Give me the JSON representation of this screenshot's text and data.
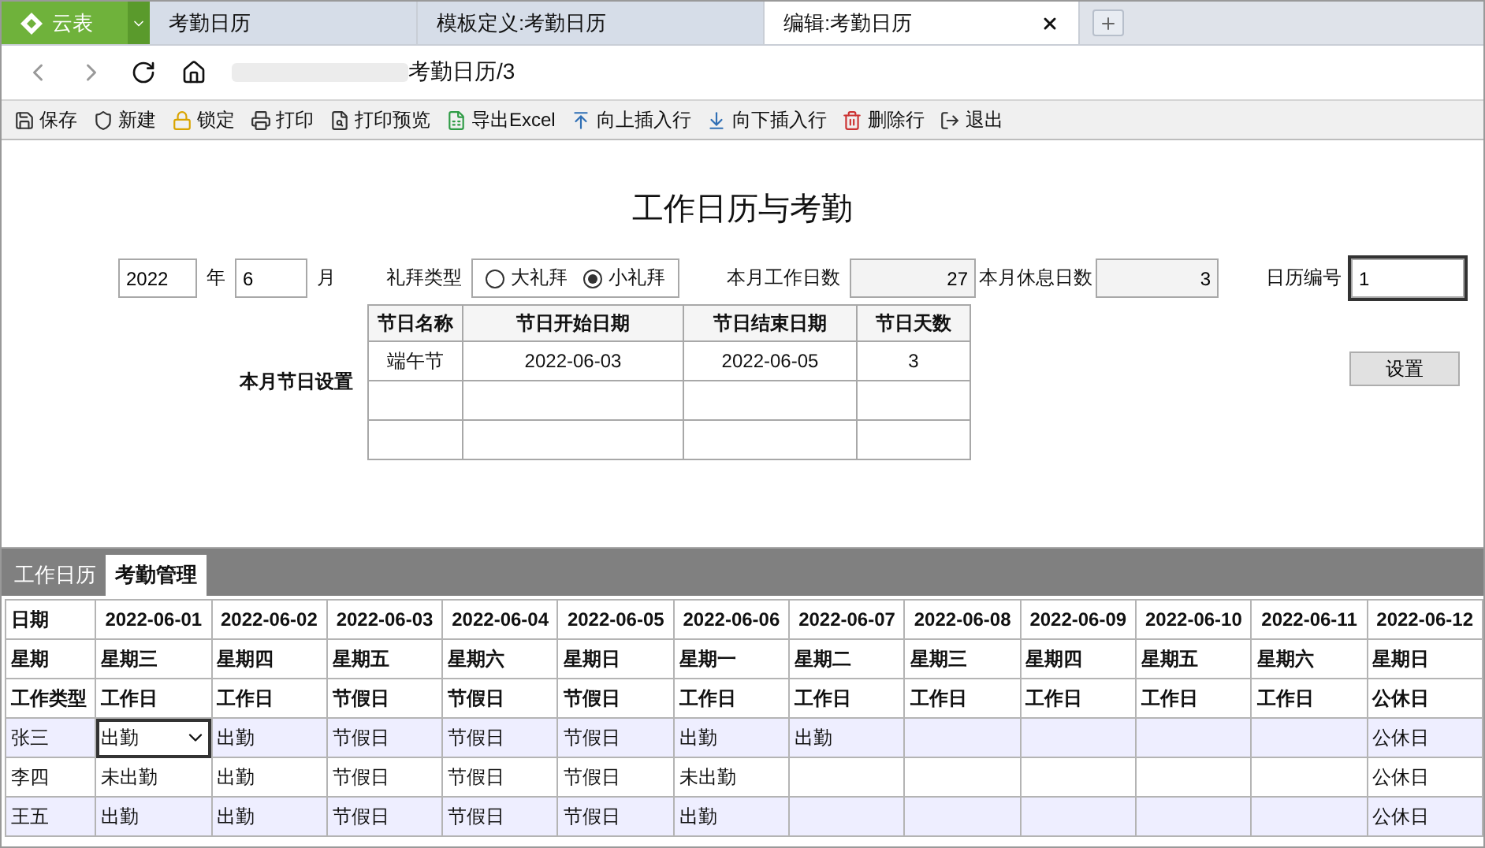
{
  "app_button": {
    "label": "云表"
  },
  "tabs": [
    {
      "label": "考勤日历",
      "selected": false
    },
    {
      "label": "模板定义:考勤日历",
      "selected": false
    },
    {
      "label": "编辑:考勤日历",
      "selected": true
    }
  ],
  "address": {
    "path": "考勤日历/3"
  },
  "toolbar": [
    {
      "label": "保存",
      "kind": "save"
    },
    {
      "label": "新建",
      "kind": "new"
    },
    {
      "label": "锁定",
      "kind": "lock"
    },
    {
      "label": "打印",
      "kind": "print"
    },
    {
      "label": "打印预览",
      "kind": "preview"
    },
    {
      "label": "导出Excel",
      "kind": "excel"
    },
    {
      "label": "向上插入行",
      "kind": "up"
    },
    {
      "label": "向下插入行",
      "kind": "down"
    },
    {
      "label": "删除行",
      "kind": "delete"
    },
    {
      "label": "退出",
      "kind": "exit"
    }
  ],
  "form": {
    "title": "工作日历与考勤",
    "year": {
      "value": "2022",
      "unit": "年"
    },
    "month": {
      "value": "6",
      "unit": "月"
    },
    "week_type": {
      "label": "礼拜类型",
      "options": [
        {
          "label": "大礼拜",
          "selected": false
        },
        {
          "label": "小礼拜",
          "selected": true
        }
      ]
    },
    "work_days": {
      "label": "本月工作日数",
      "value": "27"
    },
    "rest_days": {
      "label": "本月休息日数",
      "value": "3"
    },
    "calendar_no": {
      "label": "日历编号",
      "value": "1"
    },
    "set_button": "设置",
    "holiday_label": "本月节日设置",
    "holidays": {
      "columns": [
        "节日名称",
        "节日开始日期",
        "节日结束日期",
        "节日天数"
      ],
      "rows": [
        [
          "端午节",
          "2022-06-03",
          "2022-06-05",
          "3"
        ]
      ]
    }
  },
  "sheet_tabs": [
    {
      "label": "工作日历",
      "selected": false
    },
    {
      "label": "考勤管理",
      "selected": true
    }
  ],
  "grid": {
    "header_rows": [
      [
        "日期",
        "2022-06-01",
        "2022-06-02",
        "2022-06-03",
        "2022-06-04",
        "2022-06-05",
        "2022-06-06",
        "2022-06-07",
        "2022-06-08",
        "2022-06-09",
        "2022-06-10",
        "2022-06-11",
        "2022-06-12"
      ],
      [
        "星期",
        "星期三",
        "星期四",
        "星期五",
        "星期六",
        "星期日",
        "星期一",
        "星期二",
        "星期三",
        "星期四",
        "星期五",
        "星期六",
        "星期日"
      ],
      [
        "工作类型",
        "工作日",
        "工作日",
        "节假日",
        "节假日",
        "节假日",
        "工作日",
        "工作日",
        "工作日",
        "工作日",
        "工作日",
        "工作日",
        "公休日"
      ]
    ],
    "rows": [
      {
        "name": "张三",
        "cells": [
          {
            "text": "出勤",
            "selected": true
          },
          {
            "text": "出勤",
            "selected": false
          },
          {
            "text": "节假日",
            "selected": false
          },
          {
            "text": "节假日",
            "selected": false
          },
          {
            "text": "节假日",
            "selected": false
          },
          {
            "text": "出勤",
            "selected": false
          },
          {
            "text": "出勤",
            "selected": false
          },
          {
            "selected": false
          },
          {
            "selected": false
          },
          {
            "selected": false
          },
          {
            "selected": false
          },
          {
            "text": "公休日",
            "selected": false
          }
        ]
      },
      {
        "name": "李四",
        "cells": [
          {
            "text": "未出勤",
            "selected": false
          },
          {
            "text": "出勤",
            "selected": false
          },
          {
            "text": "节假日",
            "selected": false
          },
          {
            "text": "节假日",
            "selected": false
          },
          {
            "text": "节假日",
            "selected": false
          },
          {
            "text": "未出勤",
            "selected": false
          },
          {
            "selected": false
          },
          {
            "selected": false
          },
          {
            "selected": false
          },
          {
            "selected": false
          },
          {
            "selected": false
          },
          {
            "text": "公休日",
            "selected": false
          }
        ]
      },
      {
        "name": "王五",
        "cells": [
          {
            "text": "出勤",
            "selected": false
          },
          {
            "text": "出勤",
            "selected": false
          },
          {
            "text": "节假日",
            "selected": false
          },
          {
            "text": "节假日",
            "selected": false
          },
          {
            "text": "节假日",
            "selected": false
          },
          {
            "text": "出勤",
            "selected": false
          },
          {
            "selected": false
          },
          {
            "selected": false
          },
          {
            "selected": false
          },
          {
            "selected": false
          },
          {
            "selected": false
          },
          {
            "text": "公休日",
            "selected": false
          }
        ]
      }
    ]
  }
}
